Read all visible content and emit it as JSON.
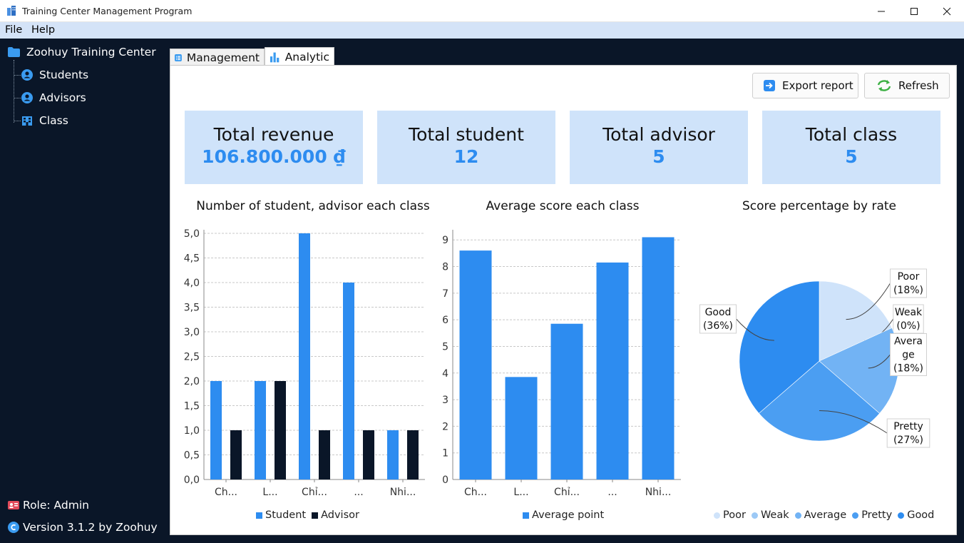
{
  "window": {
    "title": "Training Center Management Program"
  },
  "menu": {
    "file": "File",
    "help": "Help"
  },
  "sidebar": {
    "root": "Zoohuy Training Center",
    "items": [
      {
        "label": "Students",
        "icon": "user-circle-icon"
      },
      {
        "label": "Advisors",
        "icon": "user-circle-icon"
      },
      {
        "label": "Class",
        "icon": "building-icon"
      }
    ],
    "role": "Role: Admin",
    "version": "Version 3.1.2 by Zoohuy"
  },
  "tabs": {
    "management": "Management",
    "analytic": "Analytic"
  },
  "toolbar": {
    "export_label": "Export report",
    "refresh_label": "Refresh"
  },
  "stats": {
    "revenue_title": "Total revenue",
    "revenue_value": "106.800.000 ₫",
    "student_title": "Total student",
    "student_value": "12",
    "advisor_title": "Total advisor",
    "advisor_value": "5",
    "class_title": "Total class",
    "class_value": "5"
  },
  "colors": {
    "accent": "#2d8cf0",
    "dark": "#0a1628",
    "card_bg": "#cfe3fa"
  },
  "chart_data": [
    {
      "type": "bar",
      "title": "Number of student, advisor each class",
      "categories": [
        "Ch...",
        "L...",
        "Chỉ...",
        "...",
        "Nhi..."
      ],
      "series": [
        {
          "name": "Student",
          "values": [
            2,
            2,
            5,
            4,
            1
          ],
          "color": "#2d8cf0"
        },
        {
          "name": "Advisor",
          "values": [
            1,
            2,
            1,
            1,
            1
          ],
          "color": "#0a1628"
        }
      ],
      "ylim": [
        0,
        5
      ],
      "yticks": [
        "0,0",
        "0,5",
        "1,0",
        "1,5",
        "2,0",
        "2,5",
        "3,0",
        "3,5",
        "4,0",
        "4,5",
        "5,0"
      ],
      "grid": true,
      "legend": "bottom"
    },
    {
      "type": "bar",
      "title": "Average score each class",
      "categories": [
        "Ch...",
        "L...",
        "Chỉ...",
        "...",
        "Nhi..."
      ],
      "series": [
        {
          "name": "Average point",
          "values": [
            8.6,
            3.85,
            5.85,
            8.15,
            9.1
          ],
          "color": "#2d8cf0"
        }
      ],
      "ylim": [
        0,
        9.3
      ],
      "yticks": [
        "0",
        "1",
        "2",
        "3",
        "4",
        "5",
        "6",
        "7",
        "8",
        "9"
      ],
      "grid": true,
      "legend": "bottom"
    },
    {
      "type": "pie",
      "title": "Score percentage by rate",
      "slices": [
        {
          "name": "Poor",
          "value": 18,
          "label": "Poor\n(18%)",
          "color": "#cfe3fa"
        },
        {
          "name": "Weak",
          "value": 0,
          "label": "Weak\n(0%)",
          "color": "#9cc9f6"
        },
        {
          "name": "Average",
          "value": 18,
          "label": "Avera\nge\n(18%)",
          "color": "#72b3f4"
        },
        {
          "name": "Pretty",
          "value": 27,
          "label": "Pretty\n(27%)",
          "color": "#4b9ef2"
        },
        {
          "name": "Good",
          "value": 36,
          "label": "Good\n(36%)",
          "color": "#2d8cf0"
        }
      ],
      "legend": "bottom"
    }
  ]
}
